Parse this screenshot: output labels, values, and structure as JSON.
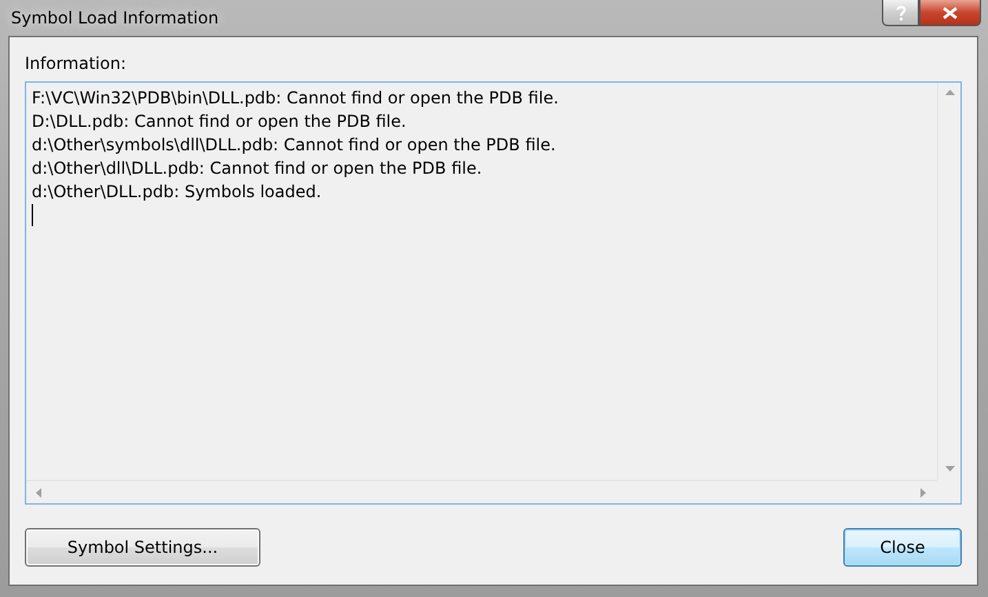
{
  "window": {
    "title": "Symbol Load Information"
  },
  "info_label": "Information:",
  "log_lines": [
    "F:\\VC\\Win32\\PDB\\bin\\DLL.pdb: Cannot find or open the PDB file.",
    "D:\\DLL.pdb: Cannot find or open the PDB file.",
    "d:\\Other\\symbols\\dll\\DLL.pdb: Cannot find or open the PDB file.",
    "d:\\Other\\dll\\DLL.pdb: Cannot find or open the PDB file.",
    "d:\\Other\\DLL.pdb: Symbols loaded."
  ],
  "buttons": [
    {
      "label": "Symbol Settings...",
      "kind": "normal"
    },
    {
      "label": "Close",
      "kind": "default"
    }
  ]
}
